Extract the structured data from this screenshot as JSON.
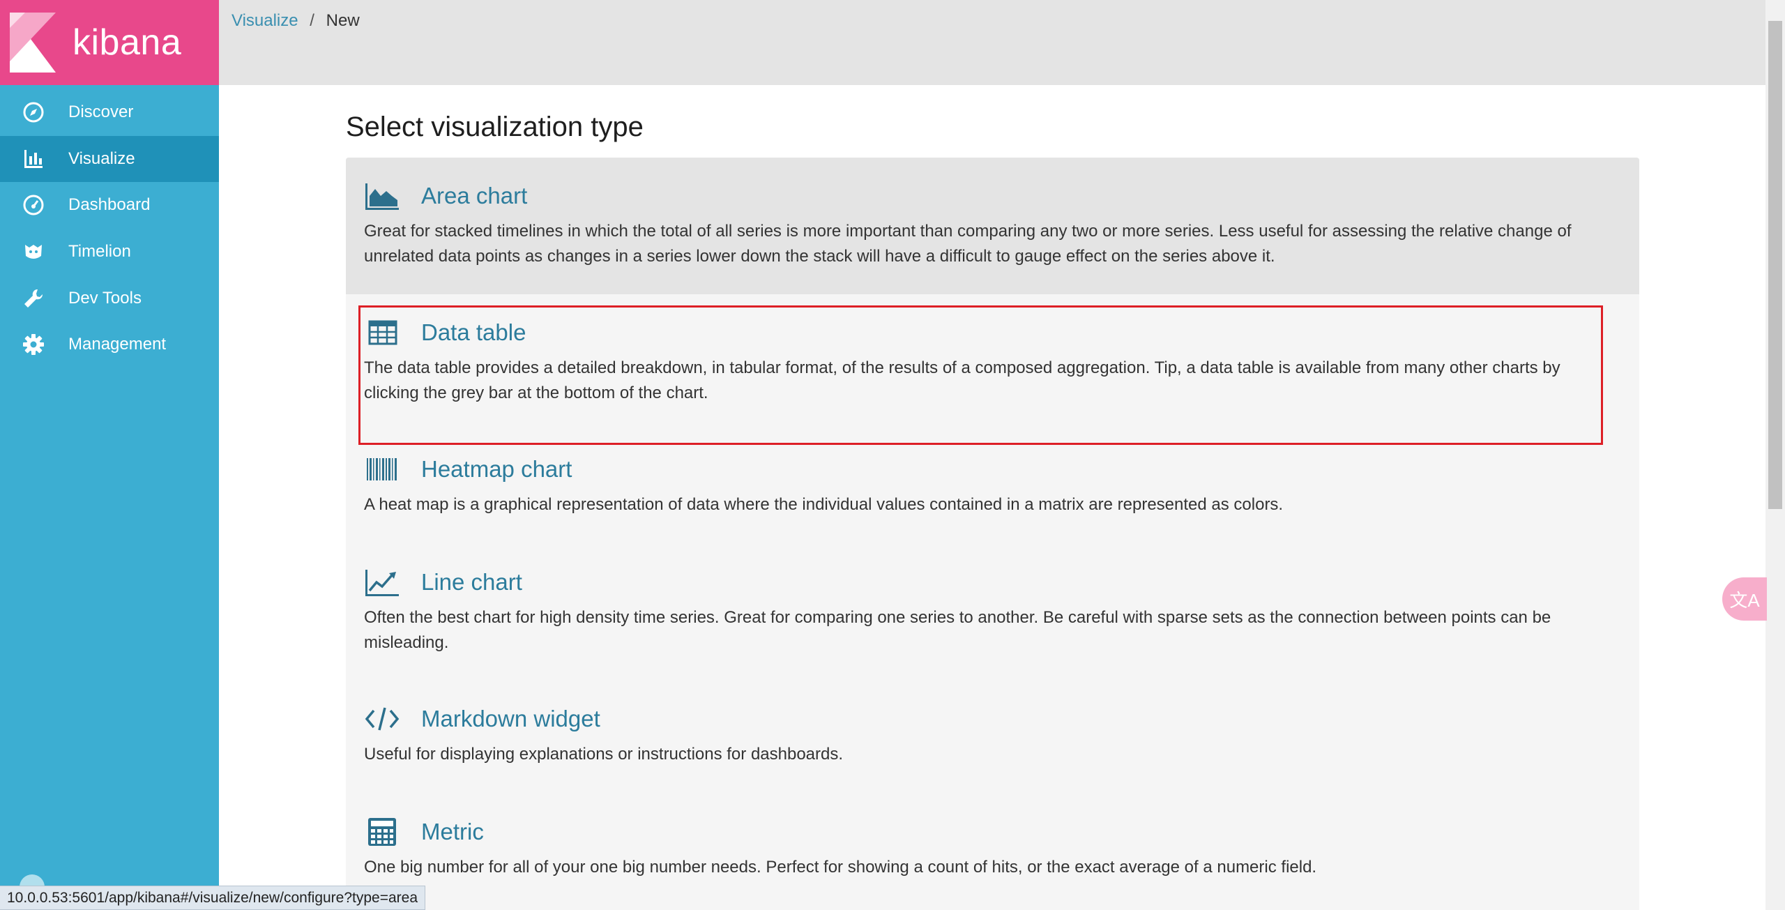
{
  "app": {
    "logo_text": "kibana"
  },
  "sidebar": {
    "items": [
      {
        "label": "Discover",
        "icon": "compass-icon"
      },
      {
        "label": "Visualize",
        "icon": "bar-chart-icon",
        "active": true
      },
      {
        "label": "Dashboard",
        "icon": "gauge-icon"
      },
      {
        "label": "Timelion",
        "icon": "timelion-icon"
      },
      {
        "label": "Dev Tools",
        "icon": "wrench-icon"
      },
      {
        "label": "Management",
        "icon": "gear-icon"
      }
    ]
  },
  "breadcrumb": {
    "parent": "Visualize",
    "separator": "/",
    "current": "New"
  },
  "main": {
    "title": "Select visualization type",
    "types": [
      {
        "name": "Area chart",
        "icon": "area-chart-icon",
        "description": "Great for stacked timelines in which the total of all series is more important than comparing any two or more series. Less useful for assessing the relative change of unrelated data points as changes in a series lower down the stack will have a difficult to gauge effect on the series above it."
      },
      {
        "name": "Data table",
        "icon": "table-icon",
        "description": "The data table provides a detailed breakdown, in tabular format, of the results of a composed aggregation. Tip, a data table is available from many other charts by clicking the grey bar at the bottom of the chart."
      },
      {
        "name": "Heatmap chart",
        "icon": "barcode-icon",
        "description": "A heat map is a graphical representation of data where the individual values contained in a matrix are represented as colors."
      },
      {
        "name": "Line chart",
        "icon": "line-chart-icon",
        "description": "Often the best chart for high density time series. Great for comparing one series to another. Be careful with sparse sets as the connection between points can be misleading."
      },
      {
        "name": "Markdown widget",
        "icon": "code-icon",
        "description": "Useful for displaying explanations or instructions for dashboards."
      },
      {
        "name": "Metric",
        "icon": "calculator-icon",
        "description": "One big number for all of your one big number needs. Perfect for showing a count of hits, or the exact average of a numeric field."
      }
    ]
  },
  "status_url": "10.0.0.53:5601/app/kibana#/visualize/new/configure?type=area",
  "translate_button": "文A",
  "colors": {
    "sidebar": "#3caed2",
    "logo_bg": "#e8488b",
    "accent_link": "#2c7c9c",
    "highlight_border": "#dd1f26"
  }
}
